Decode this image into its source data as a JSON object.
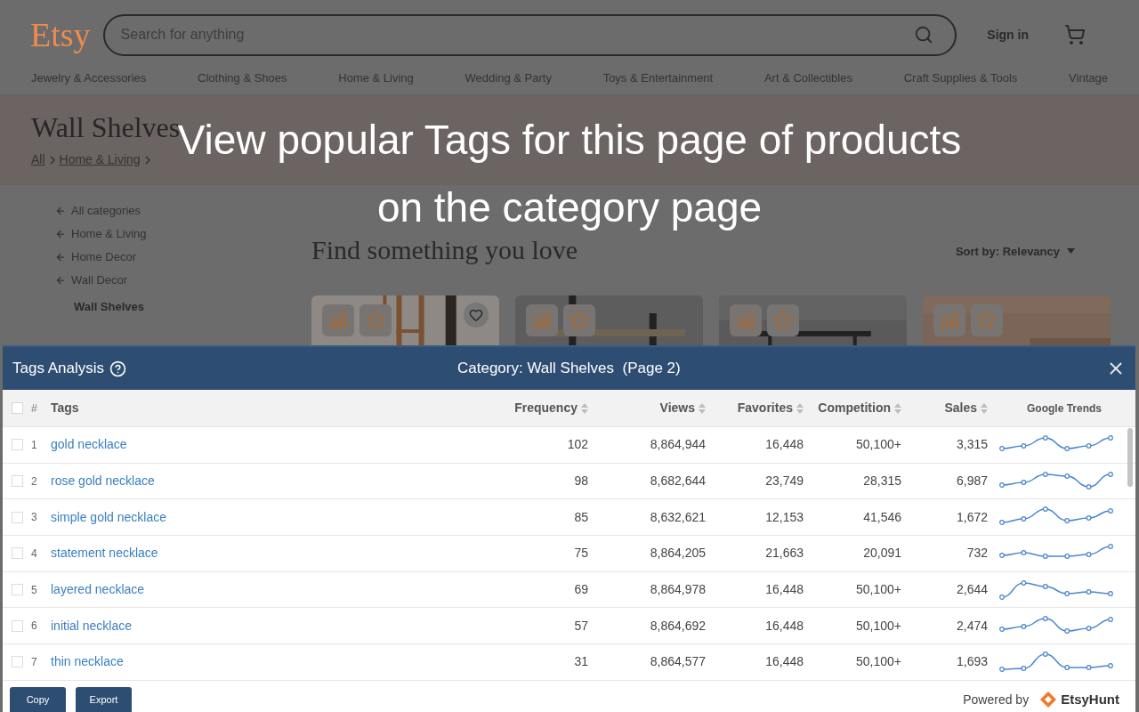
{
  "etsy_page": {
    "logo": "Etsy",
    "search": {
      "placeholder": "Search for anything"
    },
    "sign_in": "Sign in",
    "nav": [
      "Jewelry & Accessories",
      "Clothing & Shoes",
      "Home & Living",
      "Wedding & Party",
      "Toys & Entertainment",
      "Art & Collectibles",
      "Craft Supplies & Tools",
      "Vintage"
    ],
    "heading": "Wall Shelves",
    "breadcrumb": [
      "All",
      "Home & Living"
    ],
    "sidebar": [
      {
        "label": "All categories",
        "kind": "back"
      },
      {
        "label": "Home & Living",
        "kind": "back"
      },
      {
        "label": "Home Decor",
        "kind": "back"
      },
      {
        "label": "Wall Decor",
        "kind": "back"
      },
      {
        "label": "Wall Shelves",
        "kind": "current"
      }
    ],
    "title": "Find something you love",
    "sort": "Sort by: Relevancy",
    "cards": [
      {
        "heart": true
      },
      {
        "heart": false
      },
      {
        "heart": false
      },
      {
        "heart": false
      }
    ]
  },
  "caption": [
    "View popular Tags for this page of products",
    "on the category page"
  ],
  "panel": {
    "title": "Tags Analysis",
    "category": "Category: Wall Shelves  (Page 2)",
    "select_all_checked": false,
    "columns": [
      {
        "label": "#",
        "sortable": false
      },
      {
        "label": "Tags",
        "sortable": false
      },
      {
        "label": "Frequency",
        "sortable": true
      },
      {
        "label": "Views",
        "sortable": true
      },
      {
        "label": "Favorites",
        "sortable": true
      },
      {
        "label": "Competition",
        "sortable": true
      },
      {
        "label": "Sales",
        "sortable": true
      },
      {
        "label": "Google Trends",
        "sortable": false
      }
    ],
    "rows": [
      {
        "checked": false,
        "n": "1",
        "tag": "gold necklace",
        "frequency": "102",
        "views": "8,864,944",
        "favorites": "16,448",
        "competition": "50,100+",
        "sales": "3,315"
      },
      {
        "checked": false,
        "n": "2",
        "tag": "rose gold necklace",
        "frequency": "98",
        "views": "8,682,644",
        "favorites": "23,749",
        "competition": "28,315",
        "sales": "6,987"
      },
      {
        "checked": false,
        "n": "3",
        "tag": "simple gold necklace",
        "frequency": "85",
        "views": "8,632,621",
        "favorites": "12,153",
        "competition": "41,546",
        "sales": "1,672"
      },
      {
        "checked": false,
        "n": "4",
        "tag": "statement necklace",
        "frequency": "75",
        "views": "8,864,205",
        "favorites": "21,663",
        "competition": "20,091",
        "sales": "732"
      },
      {
        "checked": false,
        "n": "5",
        "tag": "layered necklace",
        "frequency": "69",
        "views": "8,864,978",
        "favorites": "16,448",
        "competition": "50,100+",
        "sales": "2,644"
      },
      {
        "checked": false,
        "n": "6",
        "tag": "initial necklace",
        "frequency": "57",
        "views": "8,864,692",
        "favorites": "16,448",
        "competition": "50,100+",
        "sales": "2,474"
      },
      {
        "checked": false,
        "n": "7",
        "tag": "thin necklace",
        "frequency": "31",
        "views": "8,864,577",
        "favorites": "16,448",
        "competition": "50,100+",
        "sales": "1,693"
      }
    ],
    "buttons": [
      "Copy",
      "Export"
    ],
    "powered_by": "Powered by",
    "brand": "EtsyHunt"
  }
}
